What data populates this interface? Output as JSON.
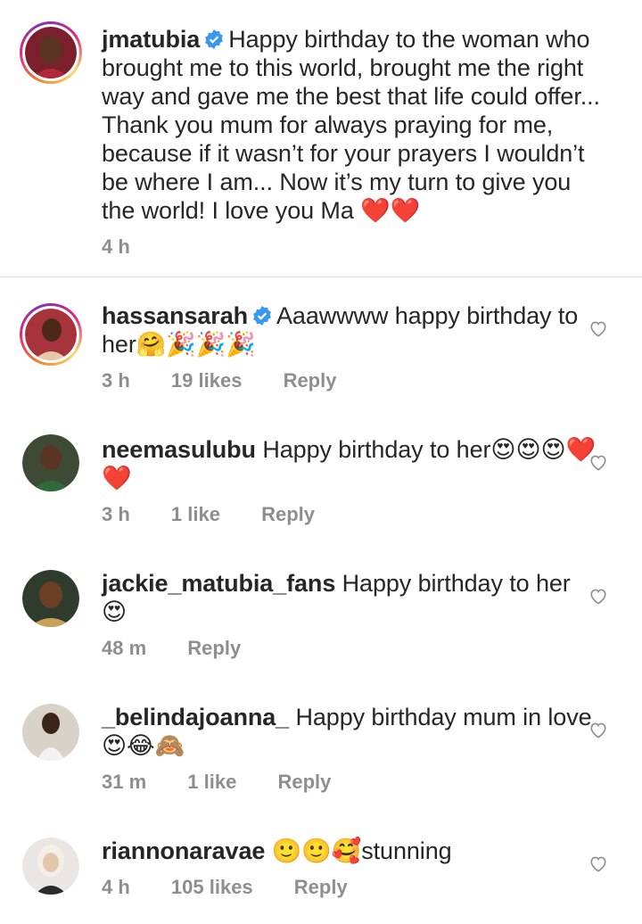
{
  "caption": {
    "username": "jmatubia",
    "verified": true,
    "text": "Happy birthday to the woman who brought me to this world, brought me the right way and gave me the best that life could offer... Thank you mum for always praying for me, because if it wasn’t for your prayers I wouldn’t be where I am... Now it’s my turn to give you the world! I love you Ma ❤️❤️",
    "time": "4 h"
  },
  "comments": [
    {
      "username": "hassansarah",
      "verified": true,
      "text": "Aaawwww happy birthday to her🤗🎉🎉🎉",
      "time": "3 h",
      "likes": "19 likes",
      "reply": "Reply"
    },
    {
      "username": "neemasulubu",
      "verified": false,
      "text": "Happy birthday to her😍😍😍❤️❤️",
      "time": "3 h",
      "likes": "1 like",
      "reply": "Reply"
    },
    {
      "username": "jackie_matubia_fans",
      "verified": false,
      "text": "Happy birthday to her 😍",
      "time": "48 m",
      "likes": "",
      "reply": "Reply"
    },
    {
      "username": "_belindajoanna_",
      "verified": false,
      "text": "Happy birthday mum in love😍😂🙈",
      "time": "31 m",
      "likes": "1 like",
      "reply": "Reply"
    },
    {
      "username": "riannonaravae",
      "verified": false,
      "text": "🙂🙂🥰stunning",
      "time": "4 h",
      "likes": "105 likes",
      "reply": "Reply"
    }
  ],
  "icons": {
    "verified": "verified-badge-icon",
    "like": "heart-outline-icon"
  },
  "colors": {
    "verified": "#3897f0",
    "meta": "#8e8e8e",
    "text": "#262626"
  }
}
